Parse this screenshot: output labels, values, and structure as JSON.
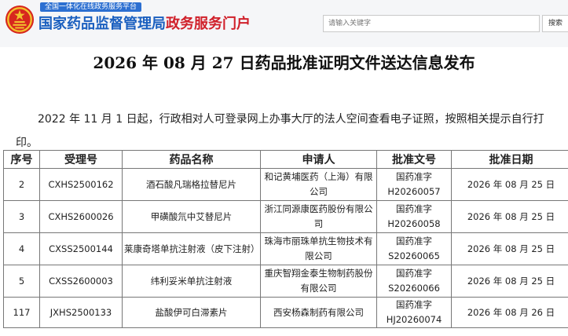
{
  "header": {
    "platform_tag": "全国一体化在线政务服务平台",
    "portal_name_main": "国家药品监督管理局",
    "portal_name_sub": "政务服务门户",
    "search_placeholder": "请输入关键字",
    "search_button": "搜索"
  },
  "colors": {
    "brand_blue": "#1a5fbf",
    "brand_red": "#d0202a",
    "tag_blue": "#2c6fd1"
  },
  "page_title": "2026 年 08 月 27 日药品批准证明文件送达信息发布",
  "notice": "2022 年 11 月 1 日起，行政相对人可登录网上办事大厅的法人空间查看电子证照，按照相关提示自行打印。",
  "table": {
    "headers": [
      "序号",
      "受理号",
      "药品名称",
      "申请人",
      "批准文号",
      "批准日期"
    ],
    "rows": [
      {
        "no": "2",
        "acceptance": "CXHS2500162",
        "drug": "酒石酸凡瑞格拉替尼片",
        "applicant": "和记黄埔医药（上海）有限公司",
        "approval_line1": "国药准字",
        "approval_line2": "H20260057",
        "date": "2026 年 08 月 25 日"
      },
      {
        "no": "3",
        "acceptance": "CXHS2600026",
        "drug": "甲磺酸氘中艾替尼片",
        "applicant": "浙江同源康医药股份有限公司",
        "approval_line1": "国药准字",
        "approval_line2": "H20260058",
        "date": "2026 年 08 月 25 日"
      },
      {
        "no": "4",
        "acceptance": "CXSS2500144",
        "drug": "莱康奇塔单抗注射液（皮下注射）",
        "applicant": "珠海市丽珠单抗生物技术有限公司",
        "approval_line1": "国药准字",
        "approval_line2": "S20260065",
        "date": "2026 年 08 月 25 日"
      },
      {
        "no": "5",
        "acceptance": "CXSS2600003",
        "drug": "纬利妥米单抗注射液",
        "applicant": "重庆智翔金泰生物制药股份有限公司",
        "approval_line1": "国药准字",
        "approval_line2": "S20260066",
        "date": "2026 年 08 月 25 日"
      },
      {
        "no": "117",
        "acceptance": "JXHS2500133",
        "drug": "盐酸伊可白滞素片",
        "applicant": "西安杨森制药有限公司",
        "approval_line1": "国药准字",
        "approval_line2": "HJ20260074",
        "date": "2026 年 08 月 26 日"
      }
    ]
  }
}
